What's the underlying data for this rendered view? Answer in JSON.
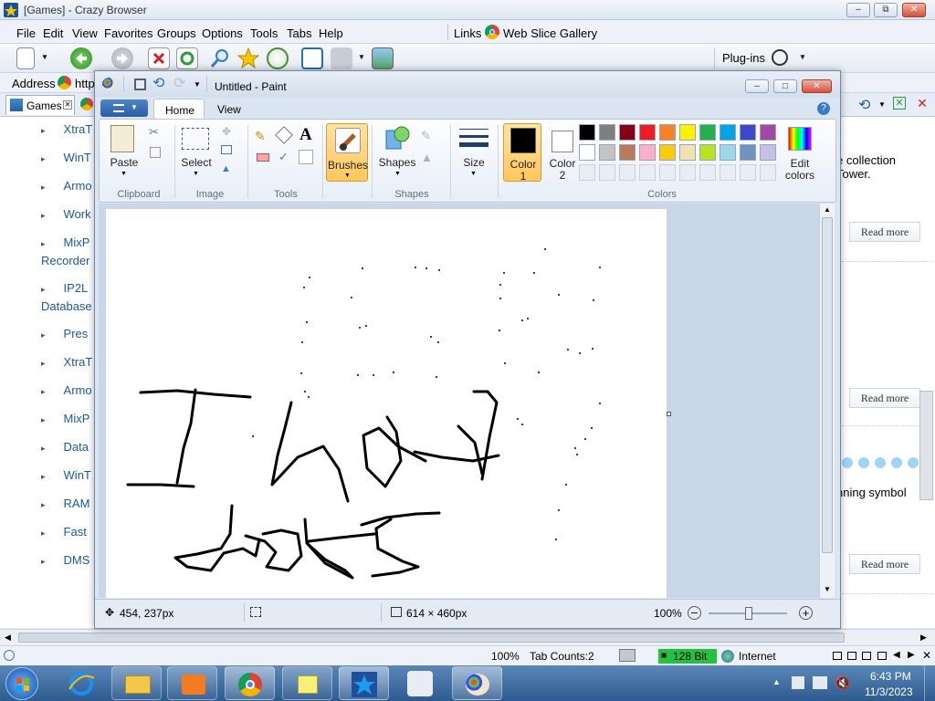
{
  "browser": {
    "title": "[Games] - Crazy Browser",
    "menu": [
      "File",
      "Edit",
      "View",
      "Favorites",
      "Groups",
      "Options",
      "Tools",
      "Tabs",
      "Help"
    ],
    "links_label": "Links",
    "web_slice_label": "Web Slice Gallery",
    "plugins_label": "Plug-ins",
    "address_label": "Address",
    "address_value": "http",
    "tab_label": "Games",
    "list_items": [
      "XtraT",
      "WinT",
      "Armo",
      "Work",
      "MixP",
      "Recorder",
      "IP2L",
      "Database",
      "Pres",
      "XtraT",
      "Armo",
      "MixP",
      "Data",
      "WinT",
      "RAM",
      "Fast",
      "DMS"
    ],
    "right_text_1": "e collection",
    "right_text_2": "Tower.",
    "right_text_3": "nning symbol",
    "read_more": "Read more",
    "status": {
      "zoom": "100%",
      "tab_counts": "Tab Counts:2",
      "bit": "128 Bit",
      "zone": "Internet"
    }
  },
  "paint": {
    "title": "Untitled - Paint",
    "tabs": [
      "Home",
      "View"
    ],
    "groups": {
      "clipboard": "Clipboard",
      "image": "Image",
      "tools": "Tools",
      "shapes": "Shapes",
      "colors": "Colors"
    },
    "buttons": {
      "paste": "Paste",
      "select": "Select",
      "brushes": "Brushes",
      "shapes": "Shapes",
      "size": "Size",
      "color1": "Color",
      "color1_num": "1",
      "color2": "Color",
      "color2_num": "2",
      "edit_colors_1": "Edit",
      "edit_colors_2": "colors"
    },
    "palette_row1": [
      "#000000",
      "#7f7f7f",
      "#880015",
      "#ed1c24",
      "#ff7f27",
      "#fff200",
      "#22b14c",
      "#00a2e8",
      "#3f48cc",
      "#a349a4"
    ],
    "palette_row2": [
      "#ffffff",
      "#c3c3c3",
      "#b97a57",
      "#ffaec9",
      "#ffc90e",
      "#efe4b0",
      "#b5e61d",
      "#99d9ea",
      "#7092be",
      "#c8bfe7"
    ],
    "status": {
      "cursor": "454, 237px",
      "size": "614 × 460px",
      "zoom": "100%"
    }
  },
  "taskbar": {
    "time": "6:43 PM",
    "date": "11/3/2023"
  }
}
